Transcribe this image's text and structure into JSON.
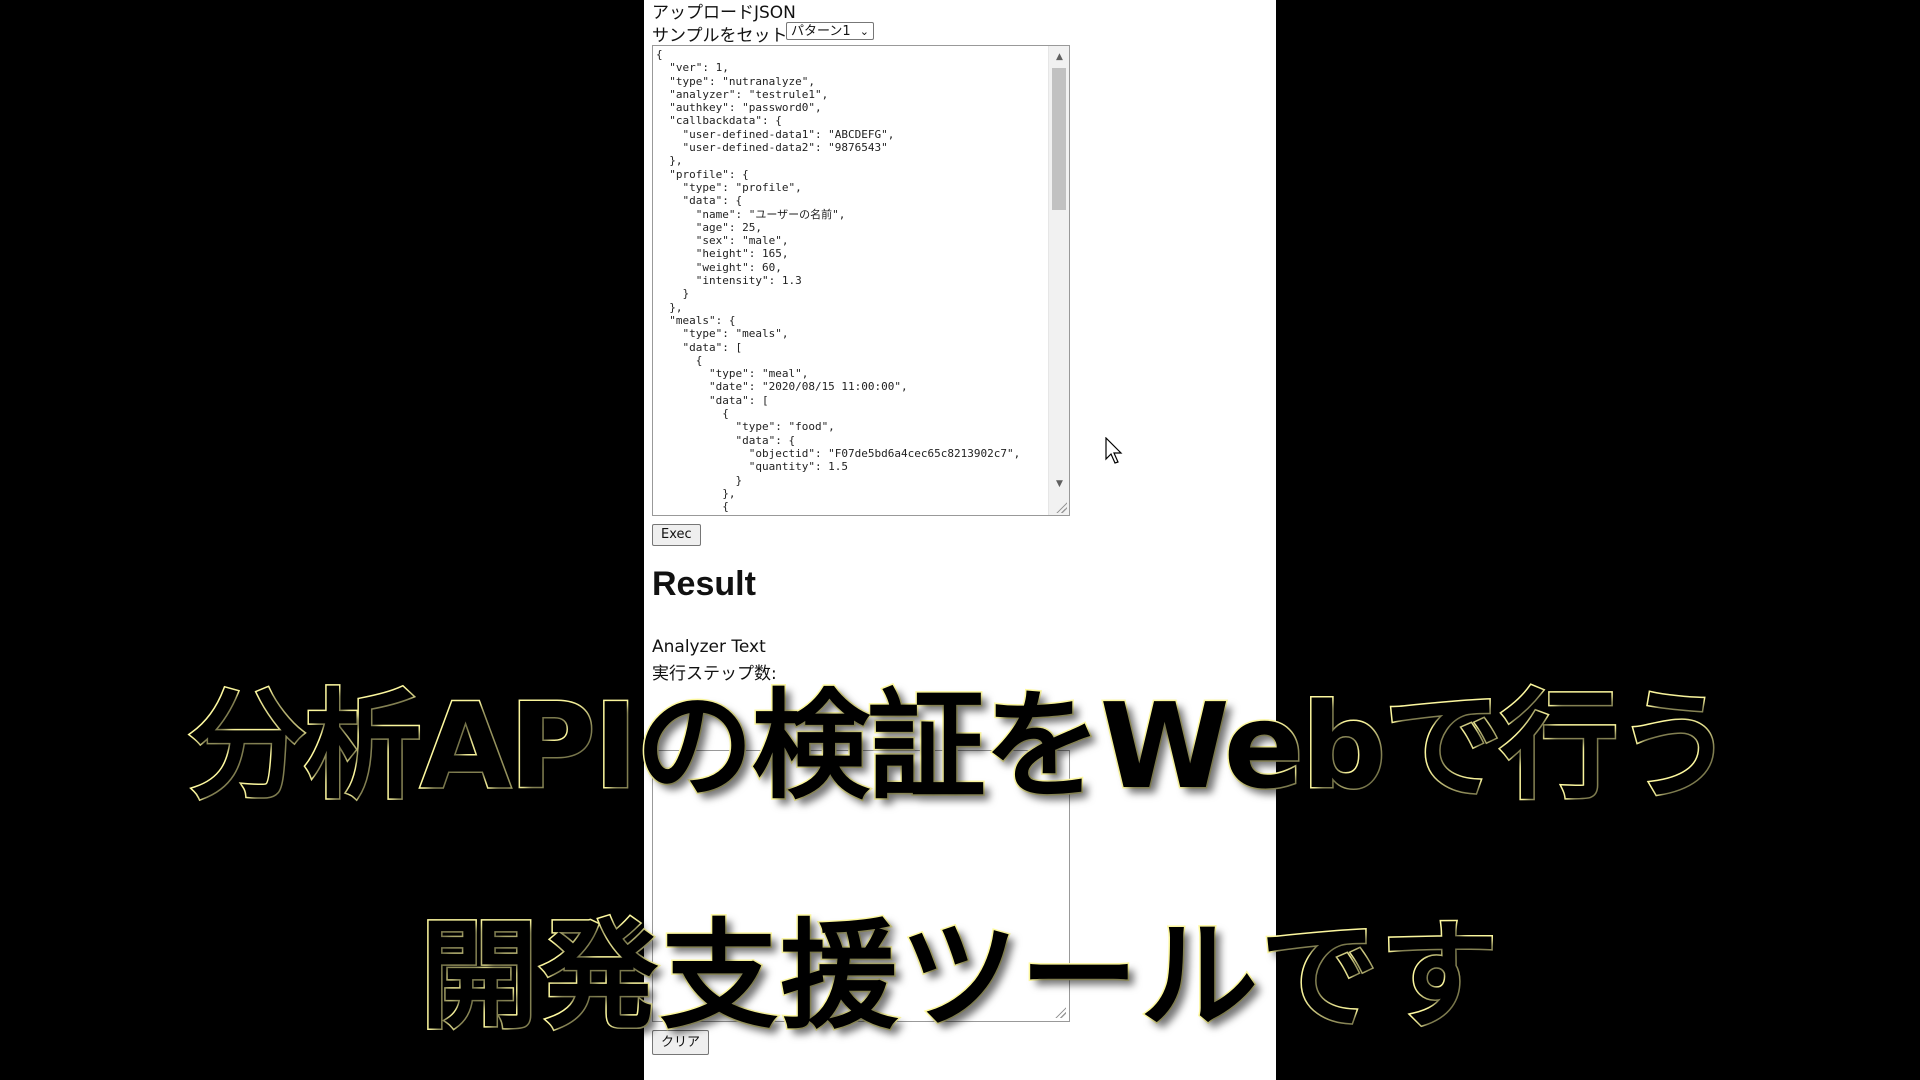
{
  "form": {
    "upload_label": "アップロードJSON",
    "sample_label": "サンプルをセット",
    "sample_selected": "パターン1",
    "json_text": "{\n  \"ver\": 1,\n  \"type\": \"nutranalyze\",\n  \"analyzer\": \"testrule1\",\n  \"authkey\": \"password0\",\n  \"callbackdata\": {\n    \"user-defined-data1\": \"ABCDEFG\",\n    \"user-defined-data2\": \"9876543\"\n  },\n  \"profile\": {\n    \"type\": \"profile\",\n    \"data\": {\n      \"name\": \"ユーザーの名前\",\n      \"age\": 25,\n      \"sex\": \"male\",\n      \"height\": 165,\n      \"weight\": 60,\n      \"intensity\": 1.3\n    }\n  },\n  \"meals\": {\n    \"type\": \"meals\",\n    \"data\": [\n      {\n        \"type\": \"meal\",\n        \"date\": \"2020/08/15 11:00:00\",\n        \"data\": [\n          {\n            \"type\": \"food\",\n            \"data\": {\n              \"objectid\": \"F07de5bd6a4cec65c8213902c7\",\n              \"quantity\": 1.5\n            }\n          },\n          {\n            \"type\": \"food\",",
    "exec_label": "Exec"
  },
  "result": {
    "heading": "Result",
    "analyzer_text_label": "Analyzer Text",
    "steps_label": "実行ステップ数:",
    "clear_label": "クリア"
  },
  "overlay": {
    "line1": "分析APIの検証をWebで行う",
    "line2": "開発支援ツールです"
  },
  "colors": {
    "background": "#000000",
    "page": "#ffffff",
    "caption_fill": "#000000",
    "caption_outline": "#fffaa0"
  },
  "icons": {
    "select_arrow": "chevron-down-icon",
    "cursor": "mouse-pointer-icon"
  }
}
